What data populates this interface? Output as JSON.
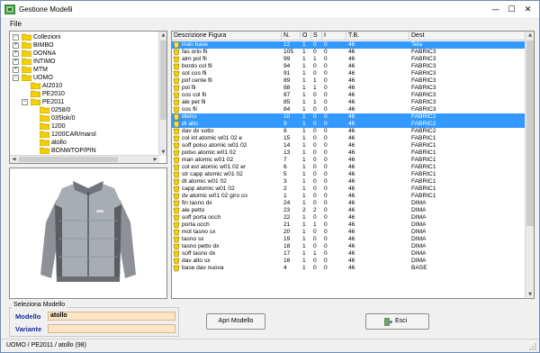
{
  "window": {
    "title": "Gestione Modelli",
    "minimize_glyph": "—",
    "maximize_glyph": "☐",
    "close_glyph": "✕"
  },
  "menu": {
    "file": "File"
  },
  "tree": {
    "root": "Collezioni",
    "items": [
      {
        "label": "BIMBO",
        "depth": 1,
        "toggle": "+"
      },
      {
        "label": "DONNA",
        "depth": 1,
        "toggle": "+"
      },
      {
        "label": "INTIMO",
        "depth": 1,
        "toggle": "+"
      },
      {
        "label": "MTM",
        "depth": 1,
        "toggle": "+"
      },
      {
        "label": "UOMO",
        "depth": 1,
        "toggle": "−"
      },
      {
        "label": "AI2010",
        "depth": 2,
        "toggle": ""
      },
      {
        "label": "PE2010",
        "depth": 2,
        "toggle": ""
      },
      {
        "label": "PE2011",
        "depth": 2,
        "toggle": "−"
      },
      {
        "label": "0258/0",
        "depth": 3,
        "toggle": ""
      },
      {
        "label": "035lok/0",
        "depth": 3,
        "toggle": ""
      },
      {
        "label": "1200",
        "depth": 3,
        "toggle": ""
      },
      {
        "label": "1200CAR/marol",
        "depth": 3,
        "toggle": ""
      },
      {
        "label": "atollo",
        "depth": 3,
        "toggle": ""
      },
      {
        "label": "BONWTOP/PIN",
        "depth": 3,
        "toggle": ""
      },
      {
        "label": "felpa",
        "depth": 3,
        "toggle": ""
      }
    ]
  },
  "table": {
    "columns": [
      "Descrizione Figura",
      "N.",
      "O",
      "S",
      "I",
      "T.B.",
      "Dest"
    ],
    "rows": [
      {
        "desc": "man base",
        "n": "12",
        "o": "1",
        "s": "0",
        "i": "0",
        "tb": "46",
        "dest": "Tela",
        "selected": true
      },
      {
        "desc": "fas orlo fli",
        "n": "105",
        "o": "1",
        "s": "0",
        "i": "0",
        "tb": "46",
        "dest": "FABRIC3",
        "selected": false
      },
      {
        "desc": "alm pol fli",
        "n": "99",
        "o": "1",
        "s": "1",
        "i": "0",
        "tb": "46",
        "dest": "FABRIC3",
        "selected": false
      },
      {
        "desc": "bordo col fli",
        "n": "94",
        "o": "1",
        "s": "0",
        "i": "0",
        "tb": "46",
        "dest": "FABRIC3",
        "selected": false
      },
      {
        "desc": "sot cos fli",
        "n": "91",
        "o": "1",
        "s": "0",
        "i": "0",
        "tb": "46",
        "dest": "FABRIC3",
        "selected": false
      },
      {
        "desc": "pof cente fli",
        "n": "89",
        "o": "1",
        "s": "1",
        "i": "0",
        "tb": "46",
        "dest": "FABRIC3",
        "selected": false
      },
      {
        "desc": "pol fli",
        "n": "88",
        "o": "1",
        "s": "1",
        "i": "0",
        "tb": "46",
        "dest": "FABRIC3",
        "selected": false
      },
      {
        "desc": "cos col fli",
        "n": "87",
        "o": "1",
        "s": "0",
        "i": "0",
        "tb": "46",
        "dest": "FABRIC3",
        "selected": false
      },
      {
        "desc": "ale pet fli",
        "n": "85",
        "o": "1",
        "s": "1",
        "i": "0",
        "tb": "46",
        "dest": "FABRIC3",
        "selected": false
      },
      {
        "desc": "cos fli",
        "n": "84",
        "o": "1",
        "s": "0",
        "i": "0",
        "tb": "46",
        "dest": "FABRIC3",
        "selected": false
      },
      {
        "desc": "dietro",
        "n": "10",
        "o": "1",
        "s": "0",
        "i": "0",
        "tb": "46",
        "dest": "FABRIC2",
        "selected": true
      },
      {
        "desc": "dt alto",
        "n": "9",
        "o": "1",
        "s": "0",
        "i": "0",
        "tb": "46",
        "dest": "FABRIC2",
        "selected": true
      },
      {
        "desc": "dav dx sotto",
        "n": "8",
        "o": "1",
        "s": "0",
        "i": "0",
        "tb": "46",
        "dest": "FABRIC2",
        "selected": false
      },
      {
        "desc": "col int atomic w01 02 e",
        "n": "15",
        "o": "1",
        "s": "0",
        "i": "0",
        "tb": "46",
        "dest": "FABRIC1",
        "selected": false
      },
      {
        "desc": "soff polso atomic w01 02",
        "n": "14",
        "o": "1",
        "s": "0",
        "i": "0",
        "tb": "46",
        "dest": "FABRIC1",
        "selected": false
      },
      {
        "desc": "polso atomic w01 02",
        "n": "13",
        "o": "1",
        "s": "0",
        "i": "0",
        "tb": "46",
        "dest": "FABRIC1",
        "selected": false
      },
      {
        "desc": "man atomic w01 02",
        "n": "7",
        "o": "1",
        "s": "0",
        "i": "0",
        "tb": "46",
        "dest": "FABRIC1",
        "selected": false
      },
      {
        "desc": "col est atomic w01 02 er",
        "n": "6",
        "o": "1",
        "s": "0",
        "i": "0",
        "tb": "46",
        "dest": "FABRIC1",
        "selected": false
      },
      {
        "desc": "str capp atomic w01 02",
        "n": "5",
        "o": "1",
        "s": "0",
        "i": "0",
        "tb": "46",
        "dest": "FABRIC1",
        "selected": false
      },
      {
        "desc": "dt atomic w01 02",
        "n": "3",
        "o": "1",
        "s": "0",
        "i": "0",
        "tb": "46",
        "dest": "FABRIC1",
        "selected": false
      },
      {
        "desc": "capp atomic w01 02",
        "n": "2",
        "o": "1",
        "s": "0",
        "i": "0",
        "tb": "46",
        "dest": "FABRIC1",
        "selected": false
      },
      {
        "desc": "dv atomic w01 02 giro co",
        "n": "1",
        "o": "1",
        "s": "0",
        "i": "0",
        "tb": "46",
        "dest": "FABRIC1",
        "selected": false
      },
      {
        "desc": "fin tasno dx",
        "n": "24",
        "o": "1",
        "s": "0",
        "i": "0",
        "tb": "46",
        "dest": "DIMA",
        "selected": false
      },
      {
        "desc": "ale petto",
        "n": "23",
        "o": "2",
        "s": "2",
        "i": "0",
        "tb": "46",
        "dest": "DIMA",
        "selected": false
      },
      {
        "desc": "soff porta occh",
        "n": "22",
        "o": "1",
        "s": "0",
        "i": "0",
        "tb": "46",
        "dest": "DIMA",
        "selected": false
      },
      {
        "desc": "porta occh",
        "n": "21",
        "o": "1",
        "s": "1",
        "i": "0",
        "tb": "46",
        "dest": "DIMA",
        "selected": false
      },
      {
        "desc": "mot tasno sx",
        "n": "20",
        "o": "1",
        "s": "0",
        "i": "0",
        "tb": "46",
        "dest": "DIMA",
        "selected": false
      },
      {
        "desc": "tasno sx",
        "n": "19",
        "o": "1",
        "s": "0",
        "i": "0",
        "tb": "46",
        "dest": "DIMA",
        "selected": false
      },
      {
        "desc": "tasno petto dx",
        "n": "18",
        "o": "1",
        "s": "0",
        "i": "0",
        "tb": "46",
        "dest": "DIMA",
        "selected": false
      },
      {
        "desc": "soff tasno dx",
        "n": "17",
        "o": "1",
        "s": "1",
        "i": "0",
        "tb": "46",
        "dest": "DIMA",
        "selected": false
      },
      {
        "desc": "dav alto sx",
        "n": "16",
        "o": "1",
        "s": "0",
        "i": "0",
        "tb": "46",
        "dest": "DIMA",
        "selected": false
      },
      {
        "desc": "base dav nuova",
        "n": "4",
        "o": "1",
        "s": "0",
        "i": "0",
        "tb": "46",
        "dest": "BASE",
        "selected": false
      }
    ]
  },
  "selection": {
    "group_title": "Seleziona Modello",
    "modello_label": "Modello",
    "modello_value": "atollo",
    "variante_label": "Variante",
    "variante_value": ""
  },
  "buttons": {
    "open": "Apri Modello",
    "exit": "Esci"
  },
  "status": {
    "text": "UOMO / PE2011 / atollo (98)"
  },
  "colors": {
    "selection": "#3399ff",
    "input_bg": "#fde5c8",
    "label_blue": "#1a2c9a",
    "folder": "#f5d000"
  }
}
